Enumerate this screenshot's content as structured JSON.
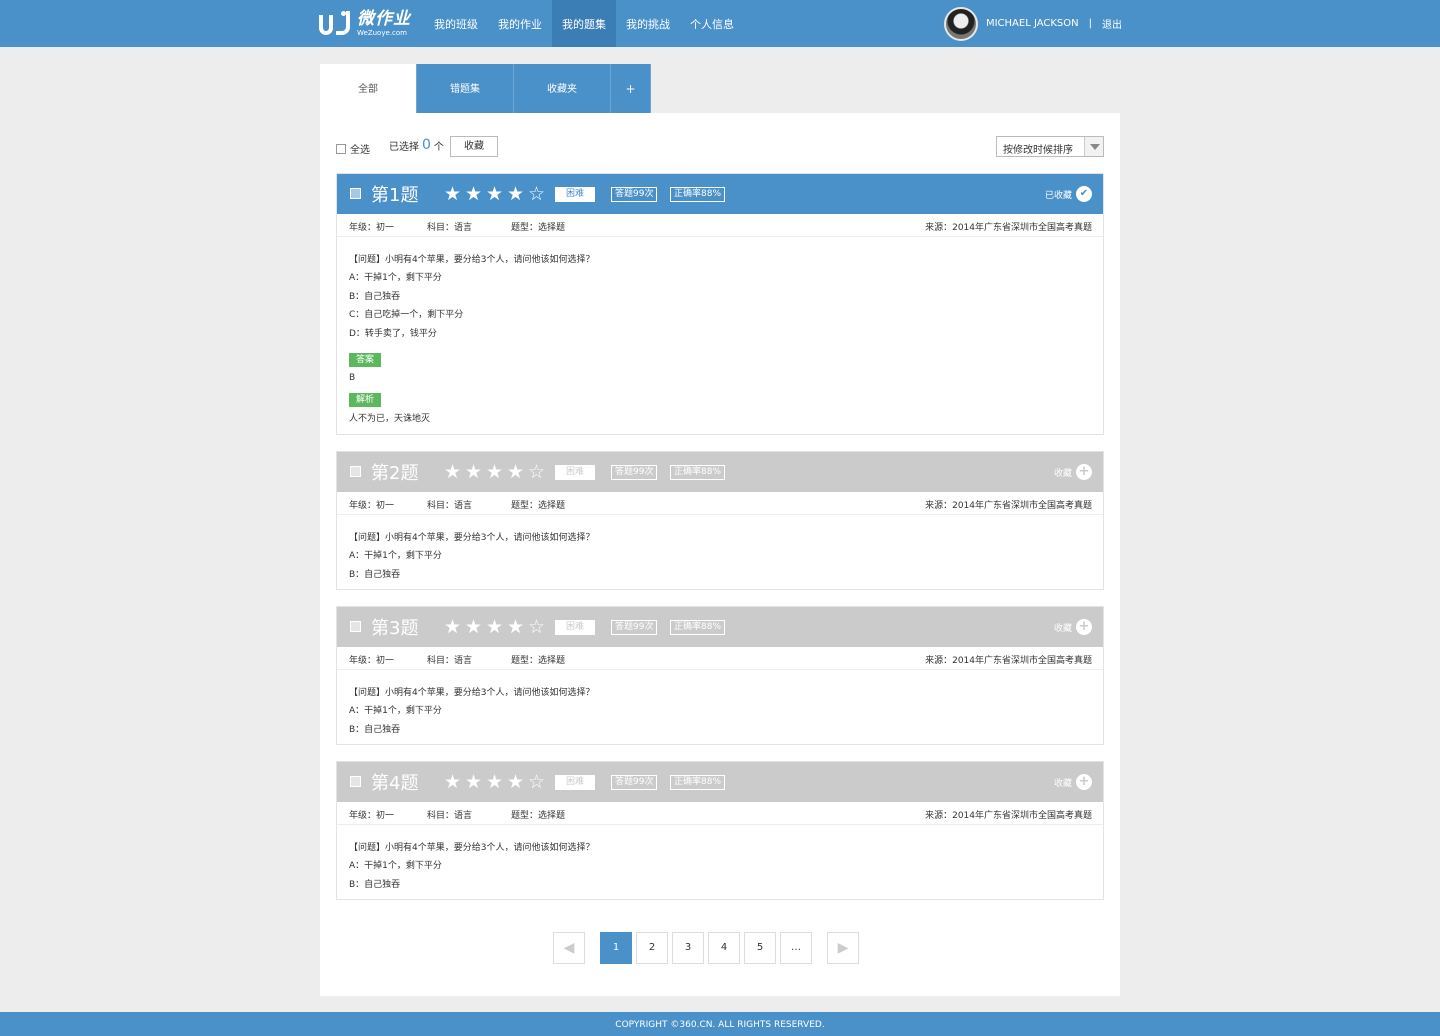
{
  "brand": {
    "name_cn": "微作业",
    "name_en": "WeZuoye.com"
  },
  "nav": [
    "我的班级",
    "我的作业",
    "我的题集",
    "我的挑战",
    "个人信息"
  ],
  "nav_active_index": 2,
  "user": {
    "name": "MICHAEL JACKSON",
    "separator": "|",
    "logout": "退出"
  },
  "tabs": [
    "全部",
    "错题集",
    "收藏夹",
    "+"
  ],
  "toolbar": {
    "select_all": "全选",
    "selected_prefix": "已选择",
    "selected_count": "0",
    "selected_suffix": "个",
    "collect_button": "收藏",
    "sort": "按修改时候排序"
  },
  "questions": [
    {
      "title": "第1题",
      "stars": 4,
      "difficulty": "困难",
      "answered": "答题99次",
      "accuracy": "正确率88%",
      "collect_label": "已收藏",
      "collected": true,
      "grade": "年级：初一",
      "subject": "科目：语言",
      "qtype": "题型：选择题",
      "source": "来源：2014年广东省深圳市全国高考真题",
      "lines": [
        "【问题】小明有4个苹果，要分给3个人，请问他该如何选择？",
        "A：干掉1个，剩下平分",
        "B：自己独吞",
        "C：自己吃掉一个，剩下平分",
        "D：转手卖了，钱平分"
      ],
      "answer_label": "答案",
      "answer": "B",
      "analysis_label": "解析",
      "analysis": "人不为已，天诛地灭"
    },
    {
      "title": "第2题",
      "stars": 4,
      "difficulty": "困难",
      "answered": "答题99次",
      "accuracy": "正确率88%",
      "collect_label": "收藏",
      "collected": false,
      "grade": "年级：初一",
      "subject": "科目：语言",
      "qtype": "题型：选择题",
      "source": "来源：2014年广东省深圳市全国高考真题",
      "lines": [
        "【问题】小明有4个苹果，要分给3个人，请问他该如何选择？",
        "A：干掉1个，剩下平分",
        "B：自己独吞"
      ]
    },
    {
      "title": "第3题",
      "stars": 4,
      "difficulty": "困难",
      "answered": "答题99次",
      "accuracy": "正确率88%",
      "collect_label": "收藏",
      "collected": false,
      "grade": "年级：初一",
      "subject": "科目：语言",
      "qtype": "题型：选择题",
      "source": "来源：2014年广东省深圳市全国高考真题",
      "lines": [
        "【问题】小明有4个苹果，要分给3个人，请问他该如何选择？",
        "A：干掉1个，剩下平分",
        "B：自己独吞"
      ]
    },
    {
      "title": "第4题",
      "stars": 4,
      "difficulty": "困难",
      "answered": "答题99次",
      "accuracy": "正确率88%",
      "collect_label": "收藏",
      "collected": false,
      "grade": "年级：初一",
      "subject": "科目：语言",
      "qtype": "题型：选择题",
      "source": "来源：2014年广东省深圳市全国高考真题",
      "lines": [
        "【问题】小明有4个苹果，要分给3个人，请问他该如何选择？",
        "A：干掉1个，剩下平分",
        "B：自己独吞"
      ]
    }
  ],
  "pagination": {
    "prev": "◀",
    "pages": [
      "1",
      "2",
      "3",
      "4",
      "5",
      "…"
    ],
    "next": "▶",
    "current": "1"
  },
  "footer": "COPYRIGHT ©360.CN. ALL RIGHTS RESERVED.",
  "colors": {
    "primary": "#4a90c9",
    "inactive_head": "#cbcbcb",
    "badge": "#5cb85c"
  }
}
